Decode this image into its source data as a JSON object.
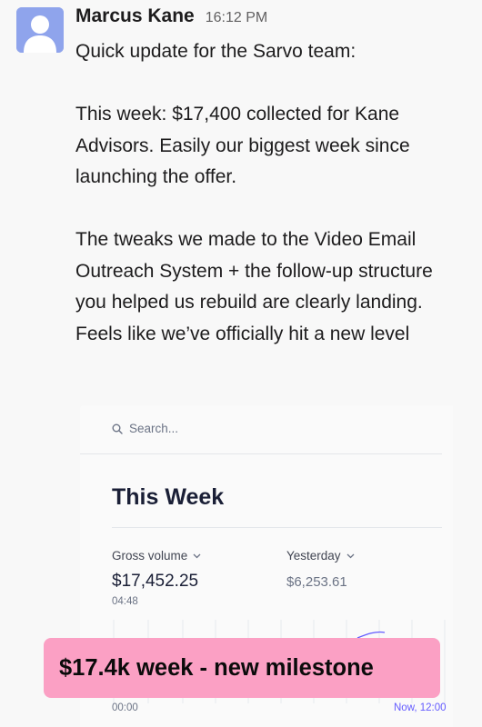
{
  "message": {
    "sender_name": "Marcus Kane",
    "time": "16:12 PM",
    "paragraphs": [
      "Quick update for the Sarvo team:",
      "This week: $17,400 collected for Kane Advisors. Easily our biggest week since launching the offer.",
      "The tweaks we made to the Video Email Outreach System + the follow-up structure you helped us rebuild are clearly landing. Feels like we’ve officially hit a new level"
    ]
  },
  "dashboard": {
    "search_placeholder": "Search...",
    "title": "This Week",
    "gross_volume_label": "Gross volume",
    "gross_volume_value": "$17,452.25",
    "gross_volume_time": "04:48",
    "yesterday_label": "Yesterday",
    "yesterday_value": "$6,253.61",
    "axis_start": "00:00",
    "axis_end": "Now, 12:00"
  },
  "banner": {
    "text": "$17.4k week - new milestone"
  },
  "colors": {
    "avatar": "#8fa4ec",
    "banner": "#fba0c4",
    "accent": "#635bff"
  },
  "icons": [
    "user-avatar-icon",
    "search-icon",
    "chevron-down-icon"
  ]
}
